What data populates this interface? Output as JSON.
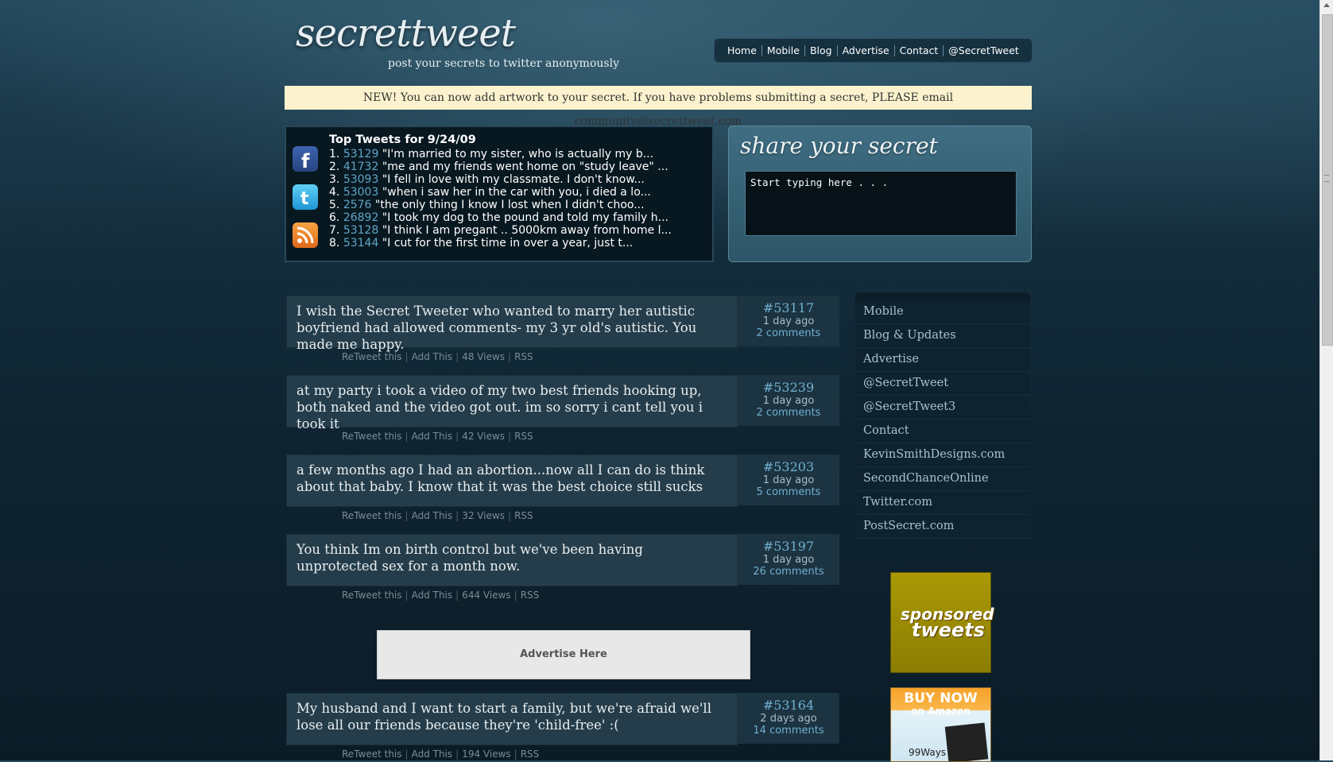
{
  "header": {
    "logo": "secrettweet",
    "tagline": "post your secrets to twitter anonymously",
    "nav": [
      "Home",
      "Mobile",
      "Blog",
      "Advertise",
      "Contact",
      "@SecretTweet"
    ]
  },
  "notice": "NEW! You can now add artwork to your secret. If you have problems submitting a secret, PLEASE email community@secrettweet.com",
  "top_tweets": {
    "title": "Top Tweets for 9/24/09",
    "social_icons": [
      "facebook-icon",
      "twitter-icon",
      "rss-icon"
    ],
    "items": [
      {
        "rank": "1.",
        "id": "53129",
        "text": "\"I'm married to my sister, who is actually my b..."
      },
      {
        "rank": "2.",
        "id": "41732",
        "text": "\"me and my friends went home on \"study leave\" ..."
      },
      {
        "rank": "3.",
        "id": "53093",
        "text": "\"I fell in love with my classmate. I don't know..."
      },
      {
        "rank": "4.",
        "id": "53003",
        "text": "\"when i saw her in the car with you, i died a lo..."
      },
      {
        "rank": "5.",
        "id": "2576",
        "text": "\"the only thing I know I lost when I didn't choo..."
      },
      {
        "rank": "6.",
        "id": "26892",
        "text": "\"I took my dog to the pound and told my family h..."
      },
      {
        "rank": "7.",
        "id": "53128",
        "text": "\"I think I am pregant .. 5000km away from home l..."
      },
      {
        "rank": "8.",
        "id": "53144",
        "text": "\"I cut for the first time in over a year, just t..."
      }
    ]
  },
  "share": {
    "title": "share your secret",
    "textarea_value": "Start typing here . . ."
  },
  "posts": [
    {
      "text": "I wish the Secret Tweeter who wanted to marry her autistic boyfriend had allowed comments- my 3 yr old's autistic. You made me happy.",
      "number": "#53117",
      "ago": "1 day ago",
      "comments": "2 comments",
      "actions": {
        "retweet": "ReTweet this",
        "add": "Add This",
        "views": "48 Views",
        "rss": "RSS"
      }
    },
    {
      "text": "at my party i took a video of my two best friends hooking up, both naked and the video got out. im so sorry i cant tell you i took it",
      "number": "#53239",
      "ago": "1 day ago",
      "comments": "2 comments",
      "actions": {
        "retweet": "ReTweet this",
        "add": "Add This",
        "views": "42 Views",
        "rss": "RSS"
      }
    },
    {
      "text": "a few months ago I had an abortion...now all I can do is think about that baby. I know that it was the best choice still sucks",
      "number": "#53203",
      "ago": "1 day ago",
      "comments": "5 comments",
      "actions": {
        "retweet": "ReTweet this",
        "add": "Add This",
        "views": "32 Views",
        "rss": "RSS"
      }
    },
    {
      "text": "You think Im on birth control but we've been having unprotected sex for a month now.",
      "number": "#53197",
      "ago": "1 day ago",
      "comments": "26 comments",
      "actions": {
        "retweet": "ReTweet this",
        "add": "Add This",
        "views": "644 Views",
        "rss": "RSS"
      }
    },
    {
      "text": "My husband and I want to start a family, but we're afraid we'll lose all our friends because they're 'child-free' :(",
      "number": "#53164",
      "ago": "2 days ago",
      "comments": "14 comments",
      "actions": {
        "retweet": "ReTweet this",
        "add": "Add This",
        "views": "194 Views",
        "rss": "RSS"
      }
    }
  ],
  "ad_banner": "Advertise Here",
  "sidebar": {
    "links": [
      "Mobile",
      "Blog & Updates",
      "Advertise",
      "@SecretTweet",
      "@SecretTweet3",
      "Contact",
      "KevinSmithDesigns.com",
      "SecondChanceOnline",
      "Twitter.com",
      "PostSecret.com"
    ]
  },
  "sponsor": {
    "line1": "sponsored",
    "line2": "tweets"
  },
  "book_ad": {
    "line1": "BUY NOW",
    "line2": "on Amazon",
    "line3": "99Ways"
  }
}
